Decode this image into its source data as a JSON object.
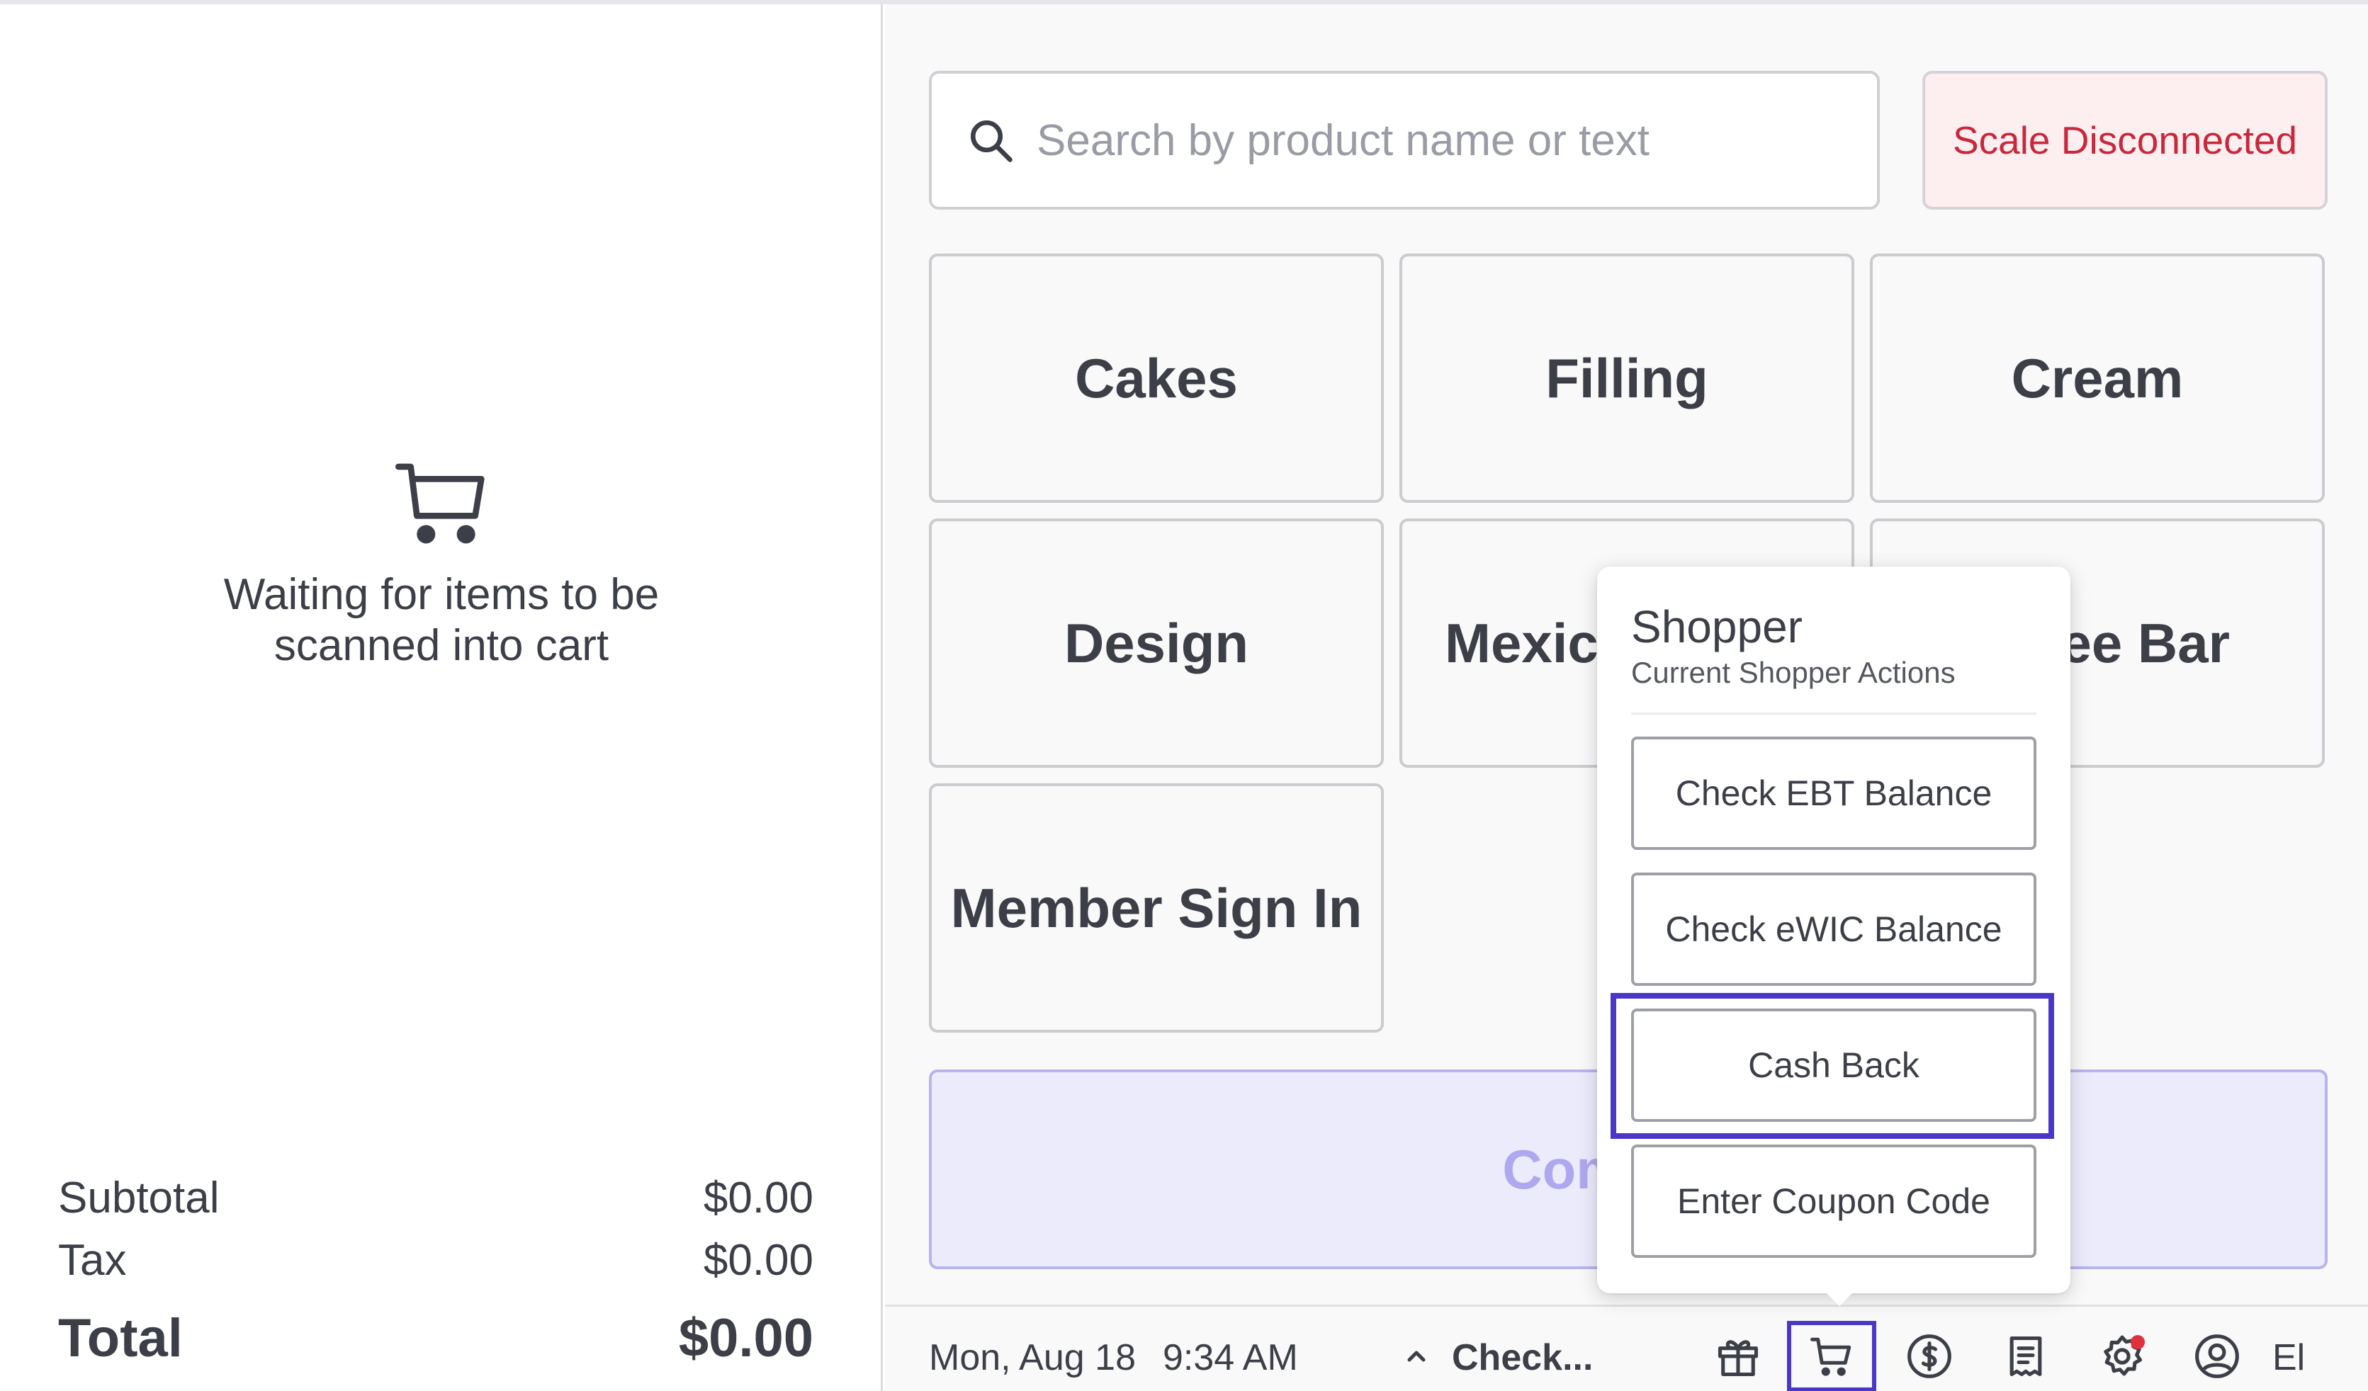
{
  "cart": {
    "empty_message": "Waiting for items to be\nscanned into cart",
    "subtotal_label": "Subtotal",
    "subtotal_value": "$0.00",
    "tax_label": "Tax",
    "tax_value": "$0.00",
    "total_label": "Total",
    "total_value": "$0.00"
  },
  "search": {
    "placeholder": "Search by product name or text",
    "value": ""
  },
  "scale_status": "Scale Disconnected",
  "tiles": [
    {
      "label": "Cakes"
    },
    {
      "label": "Filling"
    },
    {
      "label": "Cream"
    },
    {
      "label": "Design"
    },
    {
      "label": "Mexica"
    },
    {
      "label": "fee Bar"
    },
    {
      "label": "Member Sign In"
    }
  ],
  "complete_button": "Complete",
  "bottom_bar": {
    "date": "Mon, Aug 18",
    "time": "9:34 AM",
    "check_label": "Check...",
    "user_initials": "El",
    "icons": [
      "gift-icon",
      "cart-icon",
      "dollar-icon",
      "receipt-icon",
      "gear-icon",
      "user-icon"
    ]
  },
  "shopper_popup": {
    "title": "Shopper",
    "subtitle": "Current Shopper Actions",
    "actions": [
      "Check EBT Balance",
      "Check eWIC Balance",
      "Cash Back",
      "Enter Coupon Code"
    ]
  },
  "colors": {
    "accent": "#4a37c8",
    "alert_text": "#c8283c",
    "alert_bg": "#fdeef0",
    "complete_bg": "#ecebfc",
    "notification_dot": "#e0313f"
  }
}
